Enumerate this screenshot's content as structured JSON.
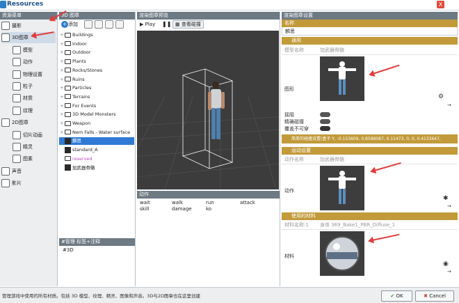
{
  "window": {
    "title": "Resources",
    "close": "X"
  },
  "left": {
    "header": "资源菜单",
    "items": [
      {
        "label": "摄影",
        "sub": false
      },
      {
        "label": "3D图章",
        "sub": false,
        "sel": true
      },
      {
        "label": "模型",
        "sub": true
      },
      {
        "label": "动作",
        "sub": true
      },
      {
        "label": "物理设置",
        "sub": true
      },
      {
        "label": "粒子",
        "sub": true
      },
      {
        "label": "材质",
        "sub": true
      },
      {
        "label": "纹理",
        "sub": true
      },
      {
        "label": "2D图章",
        "sub": false
      },
      {
        "label": "切片动画",
        "sub": true
      },
      {
        "label": "精灵",
        "sub": true
      },
      {
        "label": "图素",
        "sub": true
      },
      {
        "label": "声音",
        "sub": false
      },
      {
        "label": "影片",
        "sub": false
      }
    ]
  },
  "tree": {
    "header": "3D 图章",
    "add_label": "添加",
    "rows": [
      {
        "label": "Buildings"
      },
      {
        "label": "Indoor"
      },
      {
        "label": "Outdoor"
      },
      {
        "label": "Plants"
      },
      {
        "label": "Rocks/Stones"
      },
      {
        "label": "Ruins"
      },
      {
        "label": "Particles"
      },
      {
        "label": "Terrains"
      },
      {
        "label": "For Events"
      },
      {
        "label": "3D Model Monsters"
      },
      {
        "label": "Weapon"
      },
      {
        "label": "Nem Falls - Water surface"
      },
      {
        "label": "麟思",
        "sel": true
      },
      {
        "label": "standard_A"
      },
      {
        "label": "reserved"
      },
      {
        "label": "加武器骨骼"
      }
    ],
    "tag_header": "#管理 标签+注释",
    "tag_value": "#3D"
  },
  "preview": {
    "header": "渲染图章预览",
    "play": "Play",
    "view_collision": "查看碰撞",
    "anim_header": "动作",
    "anims": [
      [
        "wait",
        "walk",
        "run",
        "attack"
      ],
      [
        "skill",
        "damage",
        "ko",
        ""
      ]
    ]
  },
  "settings": {
    "header": "渲染图章设置",
    "name_label": "名称",
    "name_value": "麟思",
    "general": "通用",
    "model_name_label": "模型名称",
    "model_name": "加武器骨骼",
    "shape_label": "图形",
    "collision": "摇阻",
    "precise_collision": "精确碰撞",
    "invisible": "覆盖不可穿",
    "simple_collision": "简单的碰撞设置(盒子 Y, -0.153609, 0.8588087, 0.11473, 0, 0, 0.4133647,",
    "motion_header": "运动设置",
    "motion_name_label": "动作名称",
    "motion_name": "加武器骨骼",
    "motion_label": "动作",
    "material_header": "使用的材料",
    "material_name_label": "材料名称:1",
    "material_name": "身体 369_Bake1_PBR_Diffuse_1",
    "material_label": "材料"
  },
  "status": {
    "text": "管理游戏中使用的所有材质。包括 3D 模型、纹理、精灵、图像和声音。3D与2D图章也在这里创建",
    "ok": "OK",
    "cancel": "Cancel"
  }
}
